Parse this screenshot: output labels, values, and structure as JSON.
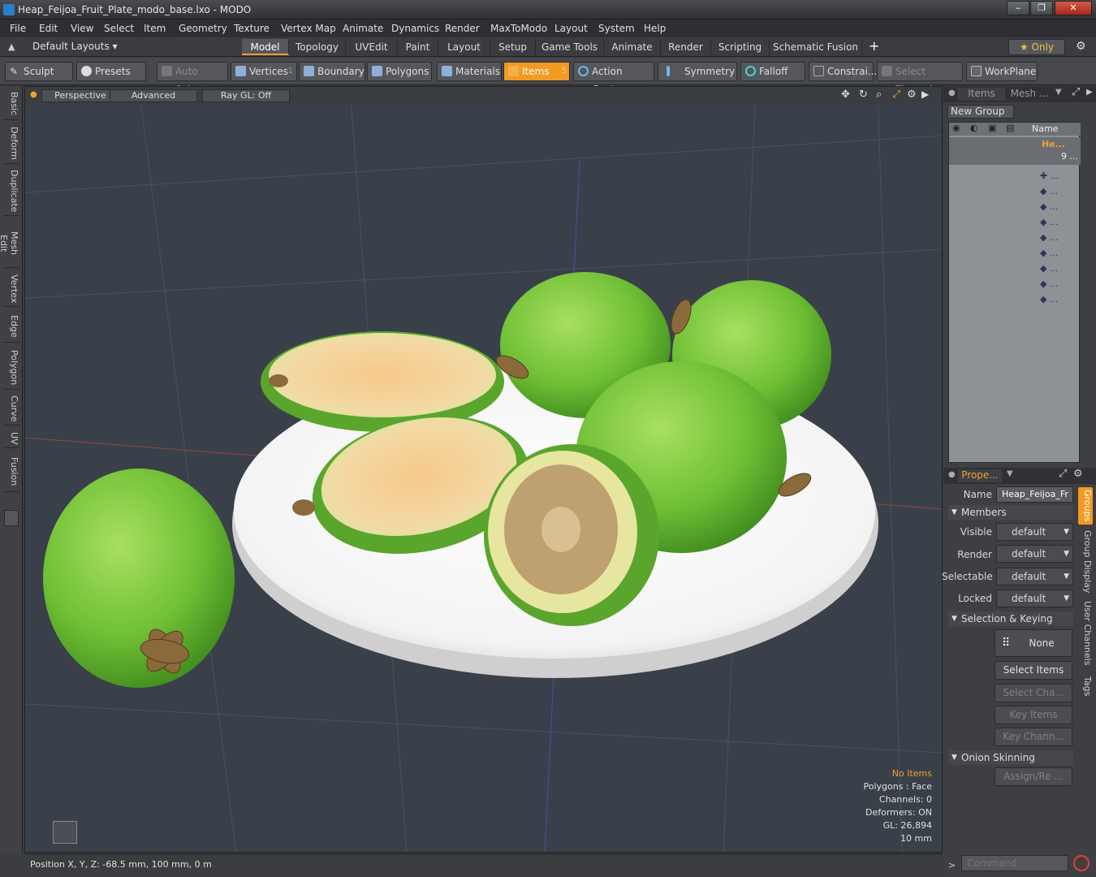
{
  "window": {
    "title": "Heap_Feijoa_Fruit_Plate_modo_base.lxo - MODO",
    "min": "‒",
    "max": "❐",
    "close": "✕"
  },
  "menu": [
    "File",
    "Edit",
    "View",
    "Select",
    "Item",
    "Geometry",
    "Texture",
    "Vertex Map",
    "Animate",
    "Dynamics",
    "Render",
    "MaxToModo",
    "Layout",
    "System",
    "Help"
  ],
  "layouts": {
    "default_layouts": "Default Layouts ▾",
    "only": "★ Only",
    "add": "+",
    "tabs": [
      "Model",
      "Topology",
      "UVEdit",
      "Paint",
      "Layout",
      "Setup",
      "Game Tools",
      "Animate",
      "Render",
      "Scripting",
      "Schematic Fusion"
    ]
  },
  "toolbar": {
    "sculpt": "Sculpt",
    "presets": "Presets",
    "auto_select": "Auto Select",
    "vertices": "Vertices",
    "vertices_count": "1",
    "boundary": "Boundary",
    "polygons": "Polygons",
    "materials": "Materials",
    "items": "Items",
    "items_count": "5",
    "action_center": "Action Center",
    "symmetry": "Symmetry",
    "falloff": "Falloff",
    "constraints": "Constrai...",
    "select_through": "Select Through",
    "workplane": "WorkPlane"
  },
  "left_tabs": [
    "Basic",
    "Deform",
    "Duplicate",
    "Mesh Edit",
    "Vertex",
    "Edge",
    "Polygon",
    "Curve",
    "UV",
    "Fusion"
  ],
  "viewport": {
    "perspective": "Perspective",
    "advanced": "Advanced",
    "raygl": "Ray GL: Off",
    "stats": [
      "No Items",
      "Polygons : Face",
      "Channels: 0",
      "Deformers: ON",
      "GL: 26,894",
      "10 mm"
    ]
  },
  "status": {
    "position": "Position X, Y, Z:  -68.5 mm, 100 mm, 0 m"
  },
  "items_panel": {
    "tab_items": "Items",
    "tab_mesh": "Mesh ...",
    "new_group": "New Group",
    "col_name": "Name",
    "group_name": "He...",
    "group_count": "9 ...",
    "child_label": "..."
  },
  "properties": {
    "tab": "Prope...",
    "name_label": "Name",
    "name_value": "Heap_Feijoa_Fr",
    "members": "Members",
    "visible": "Visible",
    "render": "Render",
    "selectable": "Selectable",
    "locked": "Locked",
    "default": "default",
    "selection_keying": "Selection & Keying",
    "none": "None",
    "select_items": "Select Items",
    "select_channels": "Select Cha...",
    "key_items": "Key Items",
    "key_channels": "Key Chann...",
    "onion_skinning": "Onion Skinning",
    "assign": "Assign/Re ...",
    "side_tabs": [
      "Groups",
      "Group Display",
      "User Channels",
      "Tags"
    ]
  },
  "command": {
    "placeholder": "Command"
  },
  "colors": {
    "accent": "#f29a22",
    "viewport_bg": "#394049",
    "fruit_green": "#78c23a"
  }
}
